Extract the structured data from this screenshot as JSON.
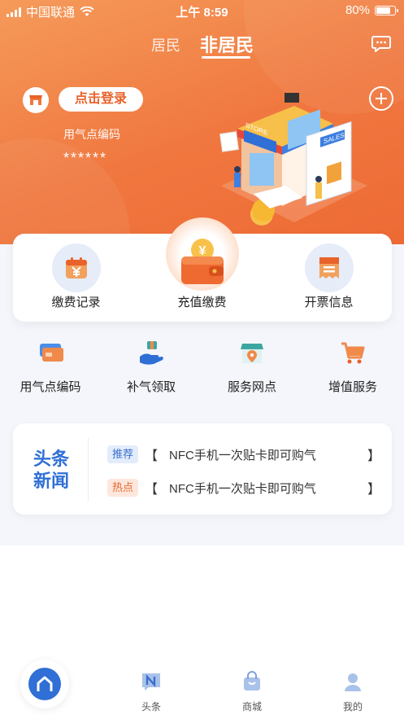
{
  "status_bar": {
    "carrier": "中国联通",
    "time": "上午 8:59",
    "battery": "80%",
    "battery_level": 0.8
  },
  "header": {
    "tabs": [
      {
        "label": "居民",
        "active": false
      },
      {
        "label": "非居民",
        "active": true
      }
    ]
  },
  "account": {
    "login_button": "点击登录",
    "gas_code_label": "用气点编码",
    "gas_code_value": "******"
  },
  "illustration": {
    "sign_text": "STORE",
    "sales_text": "SALES"
  },
  "main_actions": [
    {
      "label": "缴费记录",
      "icon": "calendar-yen-icon"
    },
    {
      "label": "充值缴费",
      "icon": "wallet-coin-icon"
    },
    {
      "label": "开票信息",
      "icon": "invoice-icon"
    }
  ],
  "services": [
    {
      "label": "用气点编码",
      "icon": "card-icon"
    },
    {
      "label": "补气领取",
      "icon": "hand-gift-icon"
    },
    {
      "label": "服务网点",
      "icon": "store-location-icon"
    },
    {
      "label": "增值服务",
      "icon": "shopping-cart-icon"
    }
  ],
  "news": {
    "logo_line1": "头条",
    "logo_line2": "新闻",
    "items": [
      {
        "tag": "推荐",
        "open": "【",
        "text": "NFC手机一次贴卡即可购气",
        "close": "】"
      },
      {
        "tag": "热点",
        "open": "【",
        "text": "NFC手机一次贴卡即可购气",
        "close": "】"
      }
    ]
  },
  "bottom_nav": [
    {
      "label": "",
      "icon": "home-icon",
      "active": true
    },
    {
      "label": "头条",
      "icon": "news-n-icon"
    },
    {
      "label": "商城",
      "icon": "shopping-bag-icon"
    },
    {
      "label": "我的",
      "icon": "user-icon"
    }
  ],
  "colors": {
    "primary_orange": "#f0773f",
    "blue": "#2f6fd6"
  }
}
